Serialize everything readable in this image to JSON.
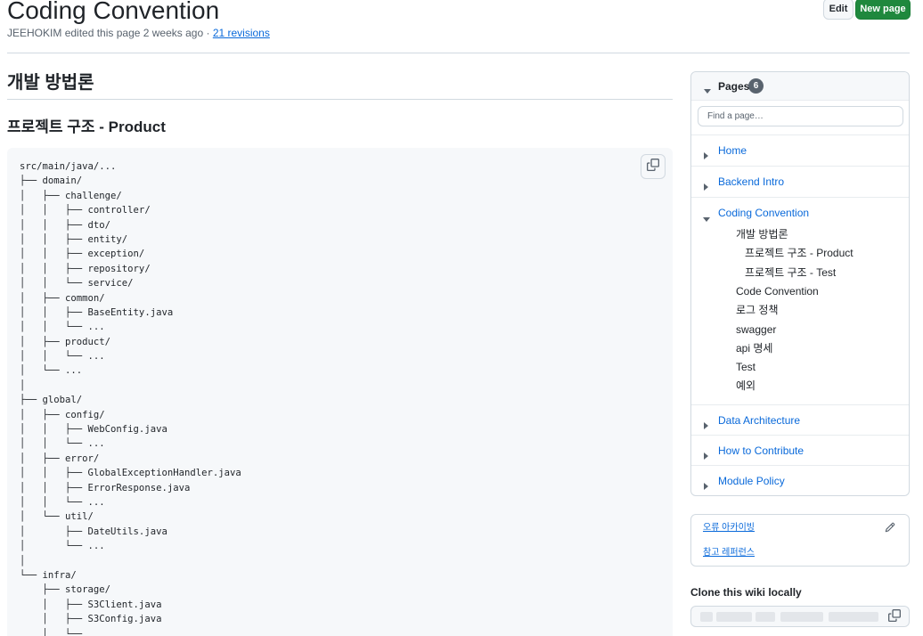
{
  "header": {
    "title": "Coding Convention",
    "editor": "JEEHOKIM",
    "edit_text": "edited this page 2 weeks ago ·",
    "revisions": "21 revisions",
    "edit_button": "Edit",
    "new_page_button": "New page"
  },
  "content": {
    "h1": "개발 방법론",
    "h2": "프로젝트 구조 - Product",
    "code": [
      "src/main/java/...",
      "├── domain/",
      "│   ├── challenge/",
      "│   │   ├── controller/",
      "│   │   ├── dto/",
      "│   │   ├── entity/",
      "│   │   ├── exception/",
      "│   │   ├── repository/",
      "│   │   └── service/",
      "│   ├── common/",
      "│   │   ├── BaseEntity.java",
      "│   │   └── ...",
      "│   ├── product/",
      "│   │   └── ...",
      "│   └── ...",
      "│",
      "├── global/",
      "│   ├── config/",
      "│   │   ├── WebConfig.java",
      "│   │   └── ...",
      "│   ├── error/",
      "│   │   ├── GlobalExceptionHandler.java",
      "│   │   ├── ErrorResponse.java",
      "│   │   └── ...",
      "│   └── util/",
      "│       ├── DateUtils.java",
      "│       └── ...",
      "│",
      "└── infra/",
      "    ├── storage/",
      "    │   ├── S3Client.java",
      "    │   ├── S3Config.java",
      "    │   └──"
    ]
  },
  "sidebar": {
    "pages_label": "Pages",
    "pages_count": "6",
    "find_placeholder": "Find a page…",
    "items": [
      {
        "label": "Home"
      },
      {
        "label": "Backend Intro"
      },
      {
        "label": "Coding Convention"
      },
      {
        "label": "Data Architecture"
      },
      {
        "label": "How to Contribute"
      },
      {
        "label": "Module Policy"
      }
    ],
    "coding_convention_children": [
      "개발 방법론",
      "프로젝트 구조 - Product",
      "프로젝트 구조 - Test",
      "Code Convention",
      "로그 정책",
      "swagger",
      "api 명세",
      "Test",
      "예외"
    ],
    "custom_links": [
      "오류 아카이빙",
      "참고 레퍼런스"
    ],
    "clone_title": "Clone this wiki locally"
  },
  "colors": {
    "link": "#0969da",
    "primary_button": "#1f883d",
    "border": "#d1d9e0",
    "code_background": "#f6f8fa"
  }
}
